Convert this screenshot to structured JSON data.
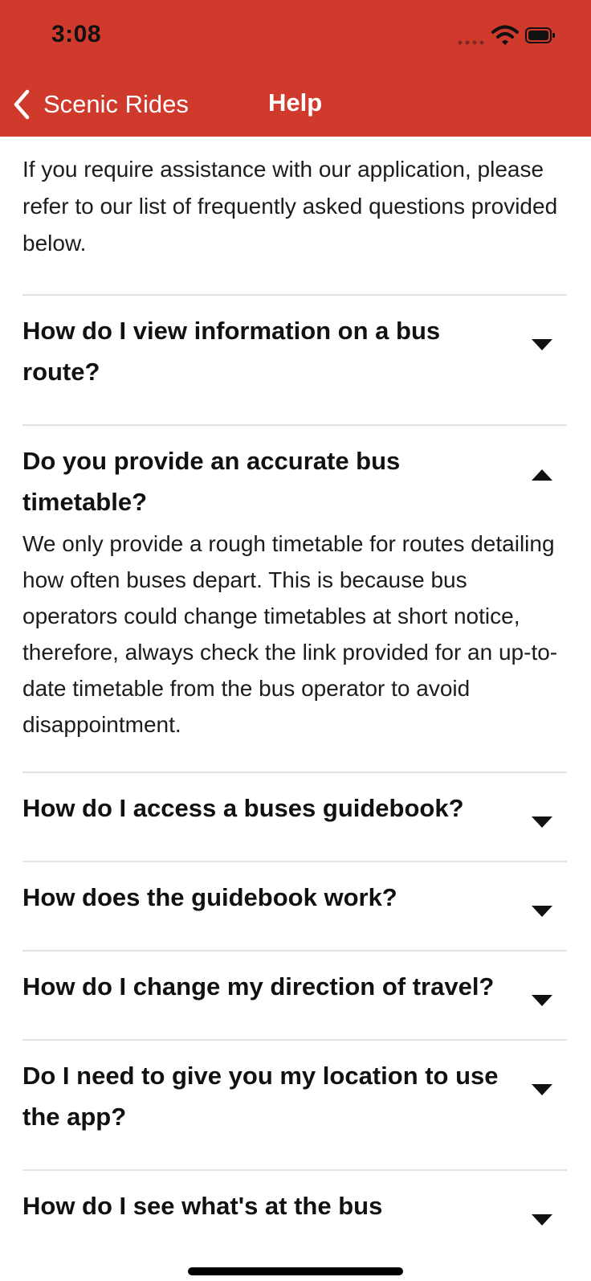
{
  "status_bar": {
    "time": "3:08"
  },
  "nav": {
    "back_label": "Scenic Rides",
    "title": "Help"
  },
  "intro": "If you require assistance with our application, please refer to our list of frequently asked questions provided below.",
  "faqs": [
    {
      "question": "How do I view information on a bus route?",
      "expanded": false,
      "answer": ""
    },
    {
      "question": "Do you provide an accurate bus timetable?",
      "expanded": true,
      "answer": "We only provide a rough timetable for routes detailing how often buses depart. This is because bus operators could change timetables at short notice, therefore, always check the link provided for an up-to-date timetable from the bus operator to avoid disappointment."
    },
    {
      "question": "How do I access a buses guidebook?",
      "expanded": false,
      "answer": ""
    },
    {
      "question": "How does the guidebook work?",
      "expanded": false,
      "answer": ""
    },
    {
      "question": "How do I change my direction of travel?",
      "expanded": false,
      "answer": ""
    },
    {
      "question": "Do I need to give you my location to use the app?",
      "expanded": false,
      "answer": ""
    },
    {
      "question": "How do I see what's at the bus",
      "expanded": false,
      "answer": ""
    }
  ],
  "colors": {
    "header": "#d03a2c",
    "divider": "#e3e3e3"
  }
}
